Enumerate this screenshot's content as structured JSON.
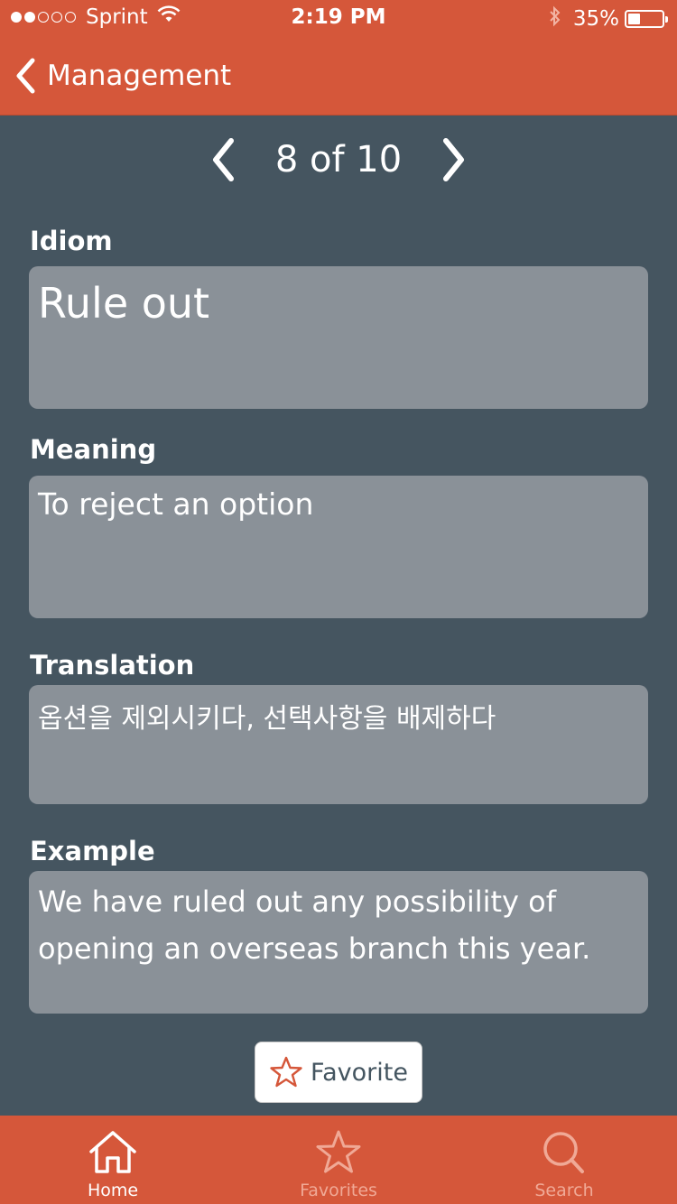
{
  "status_bar": {
    "carrier": "Sprint",
    "time": "2:19 PM",
    "battery": "35%",
    "battery_level": 0.35
  },
  "nav": {
    "back_label": "Management"
  },
  "pager": {
    "text": "8 of 10",
    "current": 8,
    "total": 10
  },
  "fields": {
    "idiom": {
      "label": "Idiom",
      "value": "Rule out"
    },
    "meaning": {
      "label": "Meaning",
      "value": "To reject an option"
    },
    "translation": {
      "label": "Translation",
      "value": "옵션을 제외시키다, 선택사항을 배제하다"
    },
    "example": {
      "label": "Example",
      "value": "We have ruled out any possibility of opening an overseas branch this year."
    }
  },
  "favorite_button": {
    "label": "Favorite",
    "icon": "star-outline-icon"
  },
  "tabs": [
    {
      "label": "Home",
      "icon": "home-icon",
      "active": true
    },
    {
      "label": "Favorites",
      "icon": "star-icon",
      "active": false
    },
    {
      "label": "Search",
      "icon": "search-icon",
      "active": false
    }
  ],
  "colors": {
    "accent": "#d5573a",
    "background": "#455560",
    "field": "#8a9198"
  }
}
